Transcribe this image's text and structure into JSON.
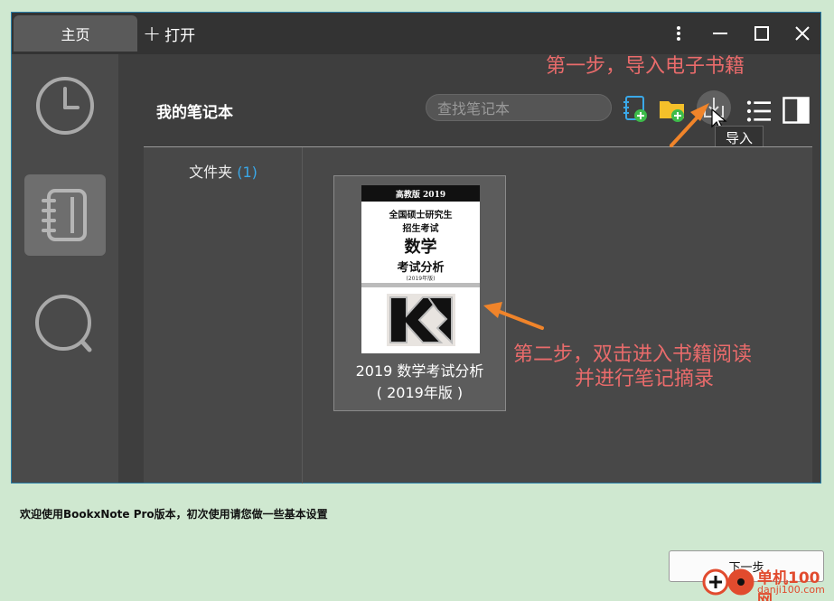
{
  "tabs": {
    "home": "主页",
    "open": "打开"
  },
  "header": {
    "title": "我的笔记本",
    "search_placeholder": "查找笔记本",
    "import_tooltip": "导入"
  },
  "folders": {
    "label": "文件夹",
    "count": "(1)"
  },
  "book": {
    "title_line1": "2019 数学考试分析",
    "title_line2": "( 2019年版 )",
    "cover": {
      "top": "高教版 2019",
      "line1": "全国硕士研究生",
      "line2": "招生考试",
      "line3": "数学",
      "line4": "考试分析",
      "line5": "(2019年版)"
    }
  },
  "annotations": {
    "step1": "第一步，导入电子书籍",
    "step2_line1": "第二步，双击进入书籍阅读",
    "step2_line2": "并进行笔记摘录"
  },
  "footer": {
    "welcome": "欢迎使用BookxNote Pro版本，初次使用请您做一些基本设置",
    "next_button": "下一步"
  },
  "watermark": {
    "line1": "单机100网",
    "line2": "danji100.com"
  },
  "colors": {
    "annotation": "#e96b6b",
    "accent": "#3aa8e8",
    "notebook_green": "#3dbb4a",
    "folder_yellow": "#f4c02a"
  }
}
